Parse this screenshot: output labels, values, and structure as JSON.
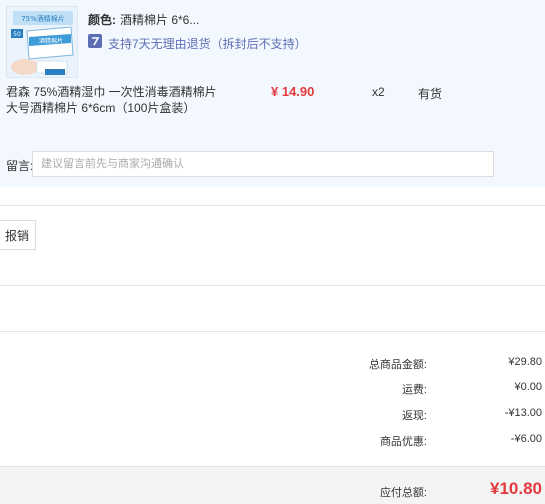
{
  "item": {
    "attr_label": "颜色:",
    "attr_value": "酒精棉片 6*6...",
    "return_policy": "支持7天无理由退货（拆封后不支持）",
    "title": "君森 75%酒精湿巾 一次性消毒酒精棉片大号酒精棉片 6*6cm（100片盒装）",
    "price": "¥ 14.90",
    "quantity": "x2",
    "stock": "有货",
    "thumbnail": {
      "badge": "50",
      "top_text": "75%酒精棉片",
      "box_text": "酒精棉片"
    }
  },
  "message": {
    "label": "留言:",
    "placeholder": "建议留言前先与商家沟通确认"
  },
  "invoice": {
    "button_label": "报销"
  },
  "summary": [
    {
      "label": "总商品金额:",
      "value": "¥29.80"
    },
    {
      "label": "运费:",
      "value": "¥0.00"
    },
    {
      "label": "返现:",
      "value": "-¥13.00"
    },
    {
      "label": "商品优惠:",
      "value": "-¥6.00"
    }
  ],
  "total": {
    "label": "应付总额:",
    "value": "¥10.80"
  },
  "colors": {
    "price_red": "#e4393c",
    "return_blue": "#5c6fb5",
    "panel_bg": "#f3f8fe"
  }
}
